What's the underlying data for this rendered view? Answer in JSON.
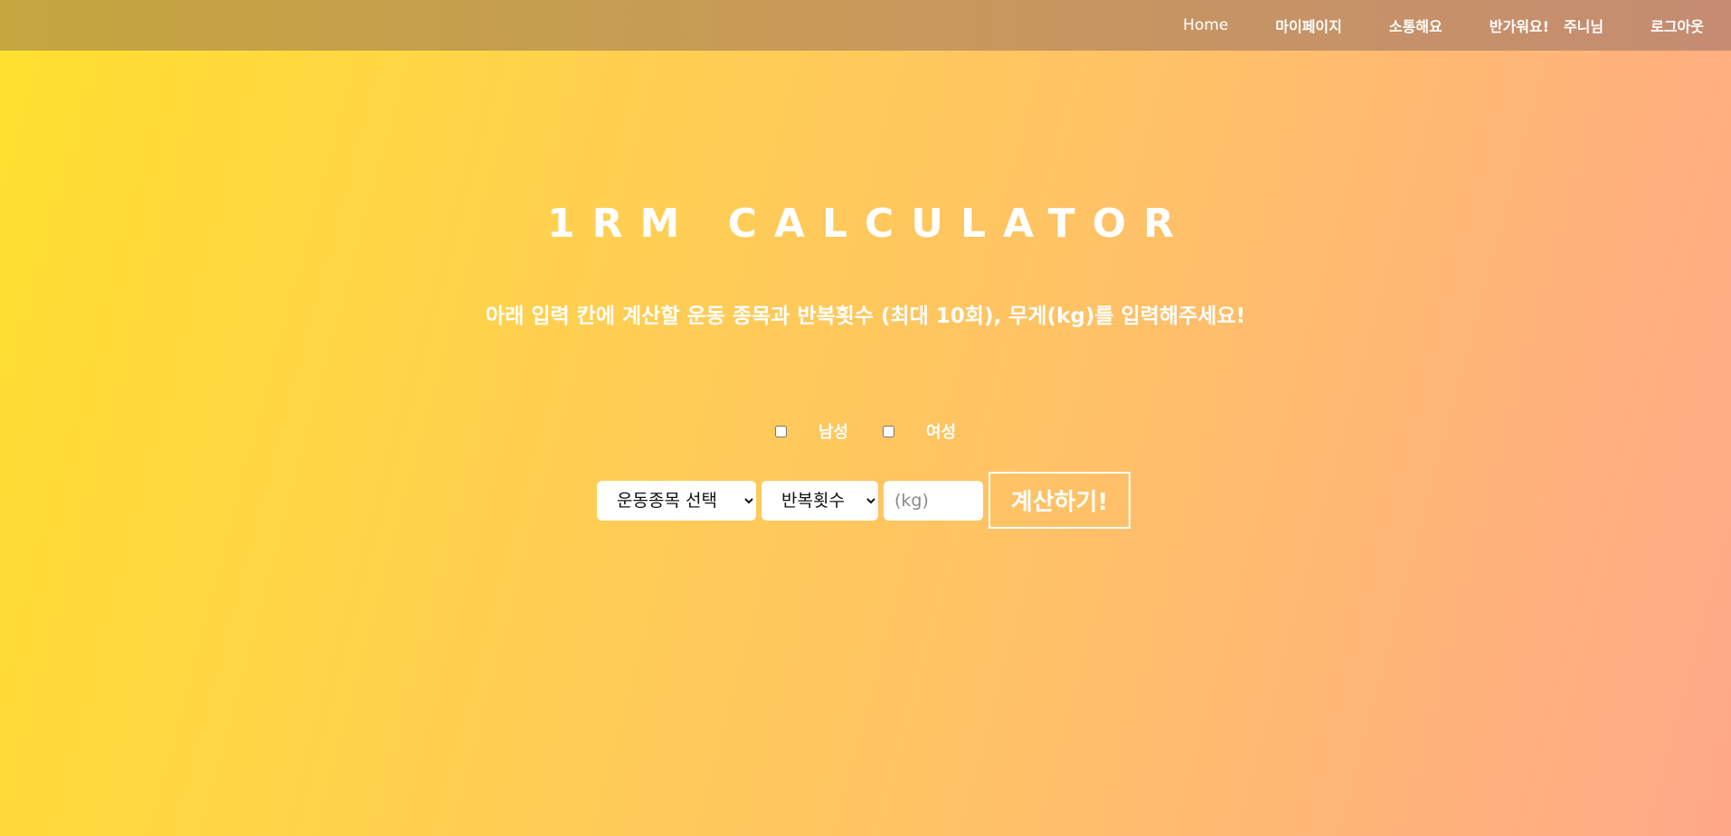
{
  "nav": {
    "home": "Home",
    "mypage": "마이페이지",
    "community": "소통해요",
    "greeting": "반가워요!",
    "username": "주니님",
    "logout": "로그아웃"
  },
  "main": {
    "title": "1RM CALCULATOR",
    "subtitle": "아래 입력 칸에 계산할 운동 종목과 반복횟수 (최대 10회), 무게(kg)를 입력해주세요!"
  },
  "gender": {
    "male_label": "남성",
    "male_checked": false,
    "female_label": "여성",
    "female_checked": false
  },
  "form": {
    "exercise_selected": "운동종목 선택",
    "reps_selected": "반복횟수",
    "weight_placeholder": "(kg)",
    "weight_value": "",
    "submit_label": "계산하기!"
  },
  "colors": {
    "gradient_start": "#ffe02e",
    "gradient_end": "#ffa889",
    "navbar": "#c7995a",
    "text": "#ffffff"
  }
}
